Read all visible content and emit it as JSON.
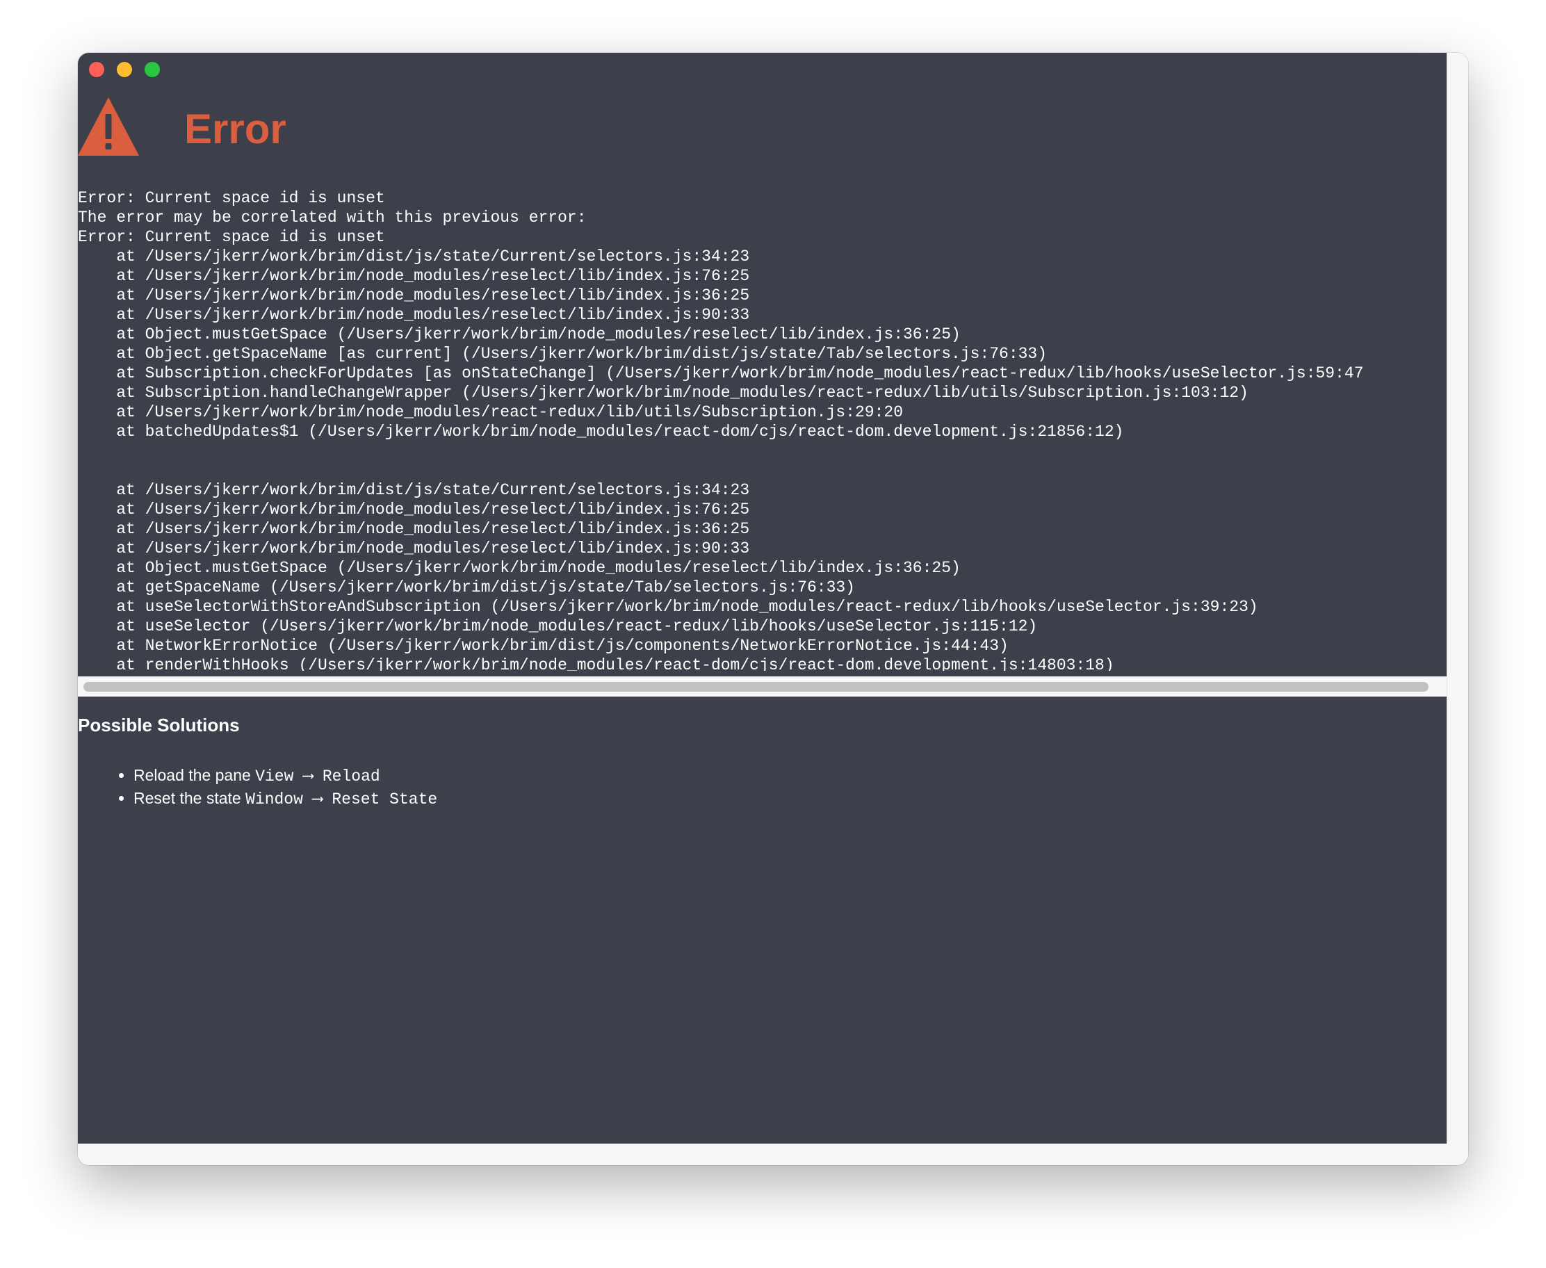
{
  "window": {
    "controls": [
      "close",
      "minimize",
      "maximize"
    ]
  },
  "error": {
    "title": "Error",
    "icon": "warning-triangle-icon",
    "accent_color": "#db5f3f",
    "background_color": "#3d404a"
  },
  "stack_trace": [
    "Error: Current space id is unset",
    "The error may be correlated with this previous error:",
    "Error: Current space id is unset",
    "    at /Users/jkerr/work/brim/dist/js/state/Current/selectors.js:34:23",
    "    at /Users/jkerr/work/brim/node_modules/reselect/lib/index.js:76:25",
    "    at /Users/jkerr/work/brim/node_modules/reselect/lib/index.js:36:25",
    "    at /Users/jkerr/work/brim/node_modules/reselect/lib/index.js:90:33",
    "    at Object.mustGetSpace (/Users/jkerr/work/brim/node_modules/reselect/lib/index.js:36:25)",
    "    at Object.getSpaceName [as current] (/Users/jkerr/work/brim/dist/js/state/Tab/selectors.js:76:33)",
    "    at Subscription.checkForUpdates [as onStateChange] (/Users/jkerr/work/brim/node_modules/react-redux/lib/hooks/useSelector.js:59:47",
    "    at Subscription.handleChangeWrapper (/Users/jkerr/work/brim/node_modules/react-redux/lib/utils/Subscription.js:103:12)",
    "    at /Users/jkerr/work/brim/node_modules/react-redux/lib/utils/Subscription.js:29:20",
    "    at batchedUpdates$1 (/Users/jkerr/work/brim/node_modules/react-dom/cjs/react-dom.development.js:21856:12)",
    "",
    "",
    "    at /Users/jkerr/work/brim/dist/js/state/Current/selectors.js:34:23",
    "    at /Users/jkerr/work/brim/node_modules/reselect/lib/index.js:76:25",
    "    at /Users/jkerr/work/brim/node_modules/reselect/lib/index.js:36:25",
    "    at /Users/jkerr/work/brim/node_modules/reselect/lib/index.js:90:33",
    "    at Object.mustGetSpace (/Users/jkerr/work/brim/node_modules/reselect/lib/index.js:36:25)",
    "    at getSpaceName (/Users/jkerr/work/brim/dist/js/state/Tab/selectors.js:76:33)",
    "    at useSelectorWithStoreAndSubscription (/Users/jkerr/work/brim/node_modules/react-redux/lib/hooks/useSelector.js:39:23)",
    "    at useSelector (/Users/jkerr/work/brim/node_modules/react-redux/lib/hooks/useSelector.js:115:12)",
    "    at NetworkErrorNotice (/Users/jkerr/work/brim/dist/js/components/NetworkErrorNotice.js:44:43)",
    "    at renderWithHooks (/Users/jkerr/work/brim/node_modules/react-dom/cjs/react-dom.development.js:14803:18)"
  ],
  "solutions": {
    "heading": "Possible Solutions",
    "items": [
      {
        "text": "Reload the pane",
        "command": "View ⟶ Reload"
      },
      {
        "text": "Reset the state",
        "command": "Window ⟶ Reset State"
      }
    ]
  }
}
